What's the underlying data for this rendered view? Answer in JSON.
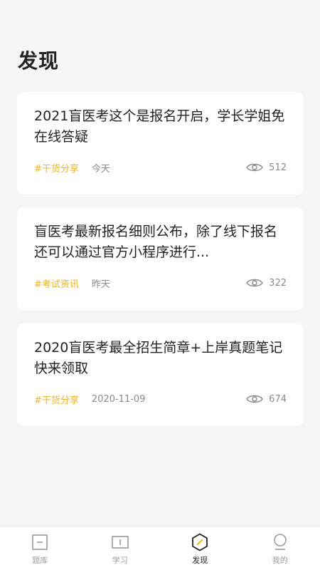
{
  "page": {
    "title": "发现"
  },
  "articles": [
    {
      "title": "2021盲医考这个是报名开启，学长学姐免在线答疑",
      "tag": "#干货分享",
      "date": "今天",
      "views": "512"
    },
    {
      "title": "盲医考最新报名细则公布，除了线下报名还可以通过官方小程序进行...",
      "tag": "#考试资讯",
      "date": "昨天",
      "views": "322"
    },
    {
      "title": "2020盲医考最全招生简章+上岸真题笔记快来领取",
      "tag": "#干货分享",
      "date": "2020-11-09",
      "views": "674"
    }
  ],
  "tabbar": {
    "items": [
      {
        "label": "题库",
        "icon": "question-bank-icon"
      },
      {
        "label": "学习",
        "icon": "study-icon"
      },
      {
        "label": "发现",
        "icon": "discover-icon",
        "active": true
      },
      {
        "label": "我的",
        "icon": "profile-icon"
      }
    ]
  },
  "colors": {
    "accent": "#f3b51b",
    "background": "#f5f5f5",
    "card": "#ffffff"
  }
}
